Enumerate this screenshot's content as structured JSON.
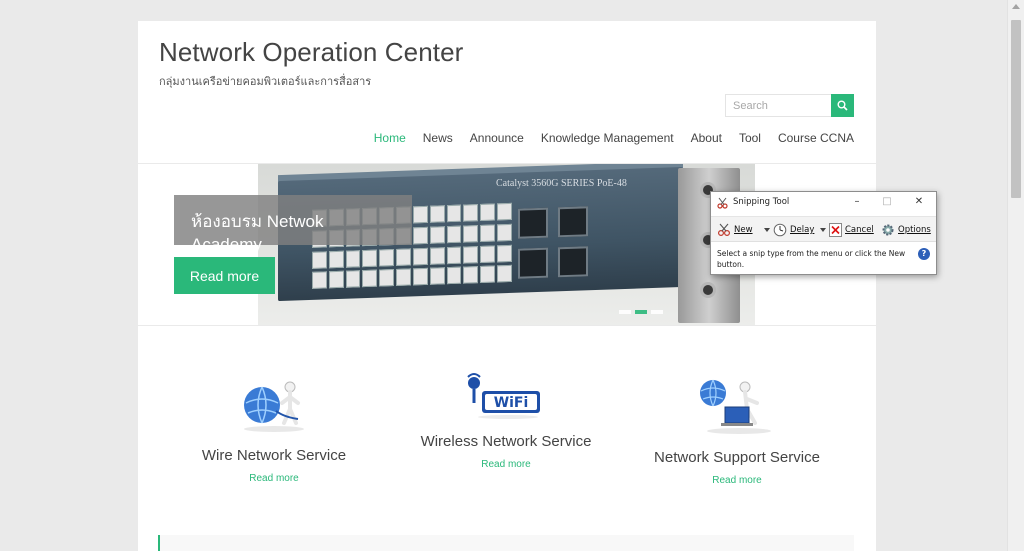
{
  "site": {
    "title": "Network Operation Center",
    "description": "กลุ่มงานเครือข่ายคอมพิวเตอร์และการสื่อสาร"
  },
  "search": {
    "placeholder": "Search"
  },
  "nav": {
    "items": [
      "Home",
      "News",
      "Announce",
      "Knowledge Management",
      "About",
      "Tool",
      "Course CCNA"
    ],
    "active": "Home"
  },
  "slider": {
    "switch_label": "Catalyst 3560G SERIES PoE-48",
    "caption": "ห้องอบรม Netwok Academy",
    "button": "Read more",
    "dot_count": 3,
    "active_dot": 2
  },
  "services": [
    {
      "title": "Wire Network Service",
      "link": "Read more",
      "icon": "wire-network-icon"
    },
    {
      "title": "Wireless Network Service",
      "link": "Read more",
      "icon": "wifi-icon"
    },
    {
      "title": "Network Support Service",
      "link": "Read more",
      "icon": "network-support-icon"
    }
  ],
  "snipping_tool": {
    "title": "Snipping Tool",
    "new_label": "New",
    "delay_label": "Delay",
    "cancel_label": "Cancel",
    "options_label": "Options",
    "message": "Select a snip type from the menu or click the New button.",
    "help": "?"
  },
  "colors": {
    "accent": "#2ab87a",
    "text": "#444444",
    "background": "#eaeaea"
  }
}
